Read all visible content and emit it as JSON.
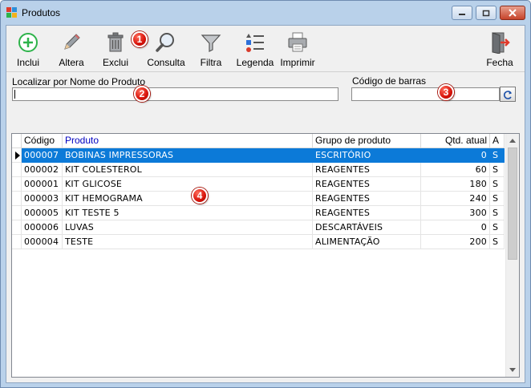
{
  "window": {
    "title": "Produtos"
  },
  "toolbar": {
    "buttons": [
      {
        "label": "Inclui",
        "icon": "plus-circle-icon"
      },
      {
        "label": "Altera",
        "icon": "pencil-icon"
      },
      {
        "label": "Exclui",
        "icon": "trash-icon"
      },
      {
        "label": "Consulta",
        "icon": "magnifier-icon"
      },
      {
        "label": "Filtra",
        "icon": "funnel-icon"
      },
      {
        "label": "Legenda",
        "icon": "legend-list-icon"
      },
      {
        "label": "Imprimir",
        "icon": "printer-icon"
      },
      {
        "label": "Fecha",
        "icon": "exit-door-icon"
      }
    ]
  },
  "search": {
    "name_label": "Localizar por Nome do Produto",
    "name_value": "",
    "barcode_label": "Código de barras",
    "barcode_value": ""
  },
  "markers": [
    "1",
    "2",
    "3",
    "4"
  ],
  "table": {
    "columns": [
      "Código",
      "Produto",
      "Grupo de produto",
      "Qtd. atual",
      "A"
    ],
    "rows": [
      {
        "codigo": "000007",
        "produto": "BOBINAS IMPRESSORAS",
        "grupo": "ESCRITÓRIO",
        "qtd": "0",
        "a": "S"
      },
      {
        "codigo": "000002",
        "produto": "KIT COLESTEROL",
        "grupo": "REAGENTES",
        "qtd": "60",
        "a": "S"
      },
      {
        "codigo": "000001",
        "produto": "KIT GLICOSE",
        "grupo": "REAGENTES",
        "qtd": "180",
        "a": "S"
      },
      {
        "codigo": "000003",
        "produto": "KIT HEMOGRAMA",
        "grupo": "REAGENTES",
        "qtd": "240",
        "a": "S"
      },
      {
        "codigo": "000005",
        "produto": "KIT TESTE 5",
        "grupo": "REAGENTES",
        "qtd": "300",
        "a": "S"
      },
      {
        "codigo": "000006",
        "produto": "LUVAS",
        "grupo": "DESCARTÁVEIS",
        "qtd": "0",
        "a": "S"
      },
      {
        "codigo": "000004",
        "produto": "TESTE",
        "grupo": "ALIMENTAÇÃO",
        "qtd": "200",
        "a": "S"
      }
    ],
    "selected_row": 0
  },
  "colors": {
    "selection": "#0c7ad8",
    "accent_green": "#2db34a",
    "marker_red": "#d8130a",
    "header_product": "#0000c0"
  }
}
